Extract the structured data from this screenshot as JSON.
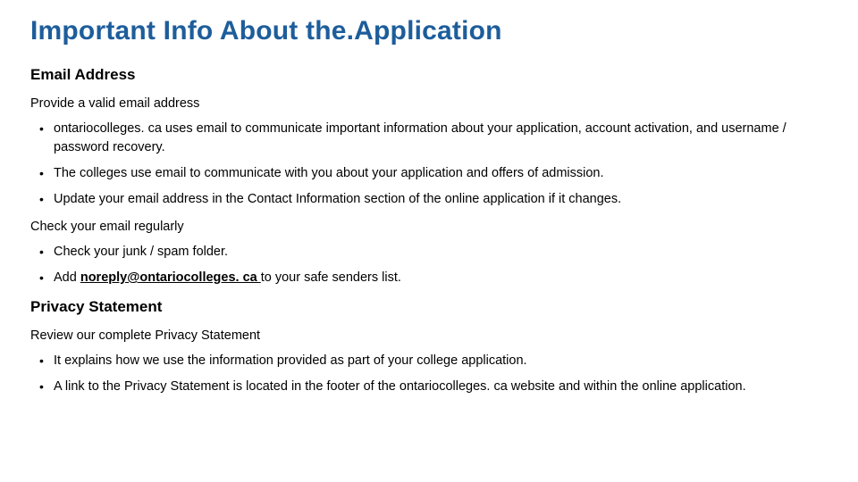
{
  "title": "Important Info About the.Application",
  "sections": [
    {
      "heading": "Email Address",
      "blocks": [
        {
          "sub": "Provide a valid email address",
          "items": [
            "ontariocolleges. ca uses email to communicate important information about your application, account activation,  and username / password recovery.",
            "The colleges use email to communicate with you about your application and offers of admission.",
            "Update your email address in the Contact Information section of the online application if it changes."
          ]
        },
        {
          "sub": "Check your email regularly",
          "items": [
            "Check your junk / spam folder."
          ],
          "email_item": {
            "prefix": "Add ",
            "email": "noreply@ontariocolleges. ca ",
            "suffix": "to your safe senders list."
          }
        }
      ]
    },
    {
      "heading": "Privacy Statement",
      "blocks": [
        {
          "sub": "Review our complete Privacy Statement",
          "items": [
            "It explains how we use the information provided as part of your college application.",
            "A link to the Privacy Statement is located in the footer of the ontariocolleges. ca website and within the online  application."
          ]
        }
      ]
    }
  ]
}
